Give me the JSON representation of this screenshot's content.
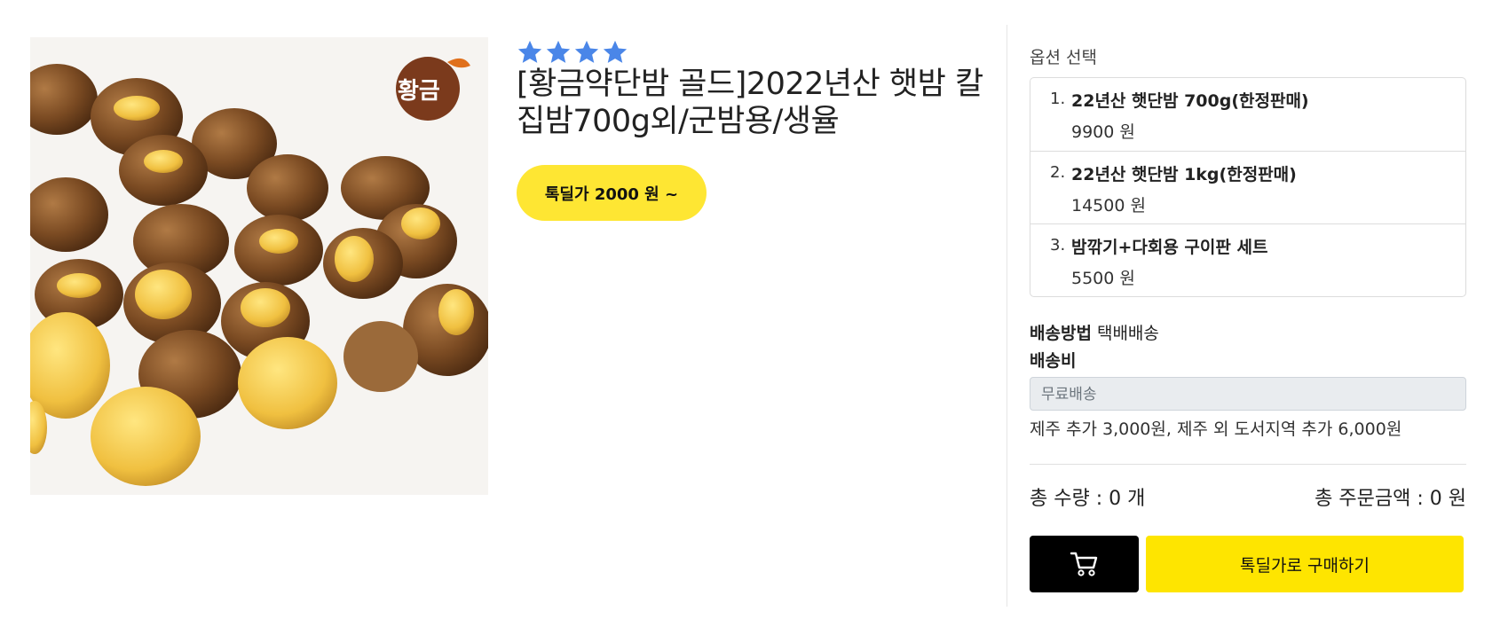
{
  "product": {
    "title": "[황금약단밤 골드]2022년산 햇밤 칼집밤700g외/군밤용/생율",
    "rating_stars": 4,
    "deal_label": "톡딜가 2000 원 ~",
    "logo_text": "황금",
    "star_color": "#4a86e8"
  },
  "options": {
    "heading": "옵션 선택",
    "items": [
      {
        "num": "1.",
        "name": "22년산 햇단밤 700g(한정판매)",
        "price": "9900 원"
      },
      {
        "num": "2.",
        "name": "22년산 햇단밤 1kg(한정판매)",
        "price": "14500 원"
      },
      {
        "num": "3.",
        "name": "밤깎기+다회용 구이판 세트",
        "price": "5500 원"
      }
    ]
  },
  "shipping": {
    "method_label": "배송방법",
    "method_value": "택배배송",
    "fee_label": "배송비",
    "fee_value": "무료배송",
    "note": "제주 추가 3,000원, 제주 외 도서지역 추가 6,000원"
  },
  "totals": {
    "quantity": "총 수량 : 0 개",
    "amount": "총 주문금액 : 0 원"
  },
  "actions": {
    "cart_icon": "cart-icon",
    "buy_label": "톡딜가로 구매하기"
  },
  "colors": {
    "accent_yellow": "#fee500",
    "deal_yellow": "#fee633",
    "cart_black": "#000000"
  }
}
